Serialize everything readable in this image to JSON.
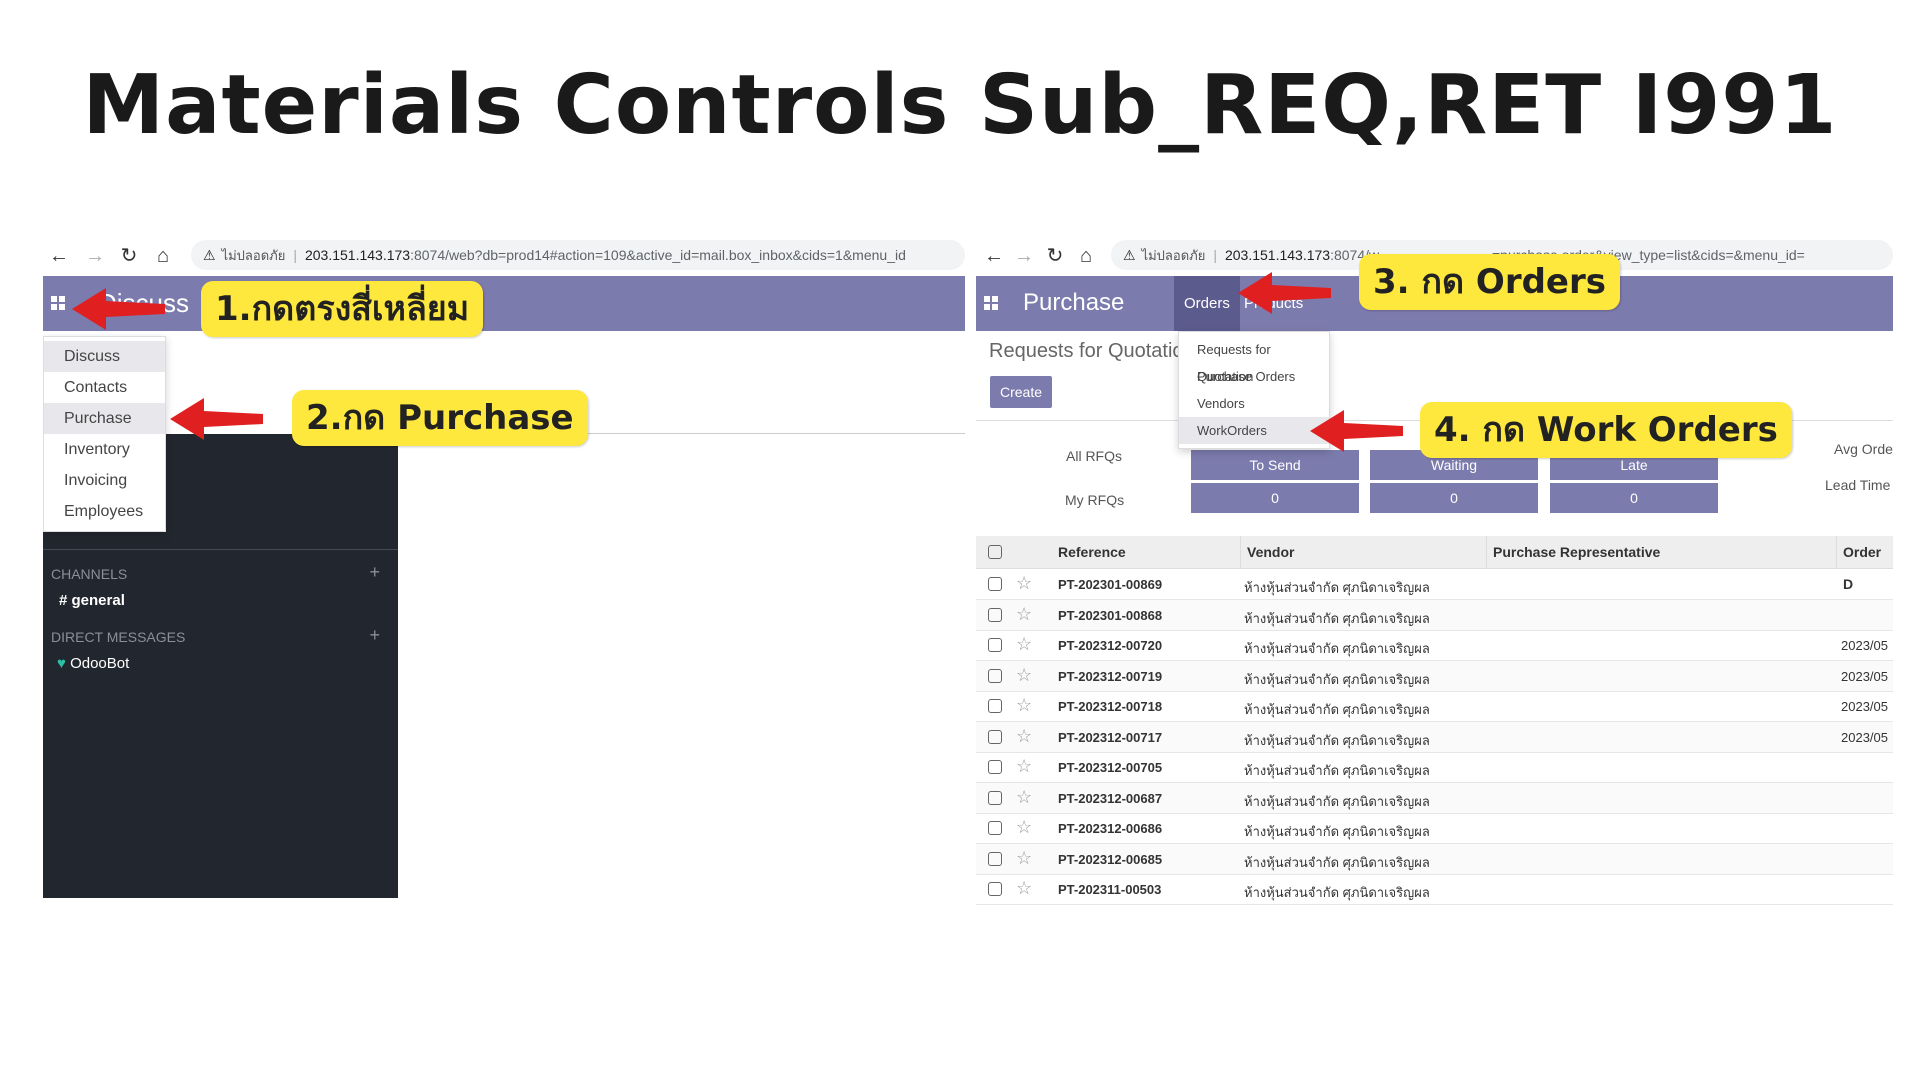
{
  "title": "Materials Controls Sub_REQ,RET I991",
  "left": {
    "security_label": "ไม่ปลอดภัย",
    "url_host": "203.151.143.173",
    "url_path": ":8074/web?db=prod14#action=109&active_id=mail.box_inbox&cids=1&menu_id",
    "app_title": "Discuss",
    "menu": [
      "Discuss",
      "Contacts",
      "Purchase",
      "Inventory",
      "Invoicing",
      "Employees"
    ],
    "channels_label": "CHANNELS",
    "channel_general": "general",
    "dm_label": "DIRECT MESSAGES",
    "dm_odoobot": "OdooBot",
    "callout1": "1.กดตรงสี่เหลี่ยม",
    "callout2": "2.กด Purchase"
  },
  "right": {
    "security_label": "ไม่ปลอดภัย",
    "url_host": "203.151.143.173",
    "url_path_a": ":8074/w",
    "url_path_b": "=purchase.order&view_type=list&cids=&menu_id=",
    "app_title": "Purchase",
    "tab_orders": "Orders",
    "tab_products": "Products",
    "orders_menu": [
      "Requests for Quotation",
      "Purchase Orders",
      "Vendors",
      "WorkOrders"
    ],
    "page_title": "Requests for Quotation",
    "create_label": "Create",
    "all_rfqs": "All RFQs",
    "my_rfqs": "My RFQs",
    "to_send": "To Send",
    "waiting": "Waiting",
    "late": "Late",
    "my_to_send": "0",
    "my_waiting": "0",
    "my_late": "0",
    "avg_order": "Avg Orde",
    "lead_time": "Lead Time",
    "columns": {
      "reference": "Reference",
      "vendor": "Vendor",
      "rep": "Purchase Representative",
      "date": "Order D"
    },
    "callout3": "3. กด Orders",
    "callout4": "4. กด Work Orders"
  },
  "rows": [
    {
      "ref": "PT-202301-00869",
      "vendor": "ห้างหุ้นส่วนจำกัด ศุภนิดาเจริญผล",
      "date": ""
    },
    {
      "ref": "PT-202301-00868",
      "vendor": "ห้างหุ้นส่วนจำกัด ศุภนิดาเจริญผล",
      "date": ""
    },
    {
      "ref": "PT-202312-00720",
      "vendor": "ห้างหุ้นส่วนจำกัด ศุภนิดาเจริญผล",
      "date": "2023/05"
    },
    {
      "ref": "PT-202312-00719",
      "vendor": "ห้างหุ้นส่วนจำกัด ศุภนิดาเจริญผล",
      "date": "2023/05"
    },
    {
      "ref": "PT-202312-00718",
      "vendor": "ห้างหุ้นส่วนจำกัด ศุภนิดาเจริญผล",
      "date": "2023/05"
    },
    {
      "ref": "PT-202312-00717",
      "vendor": "ห้างหุ้นส่วนจำกัด ศุภนิดาเจริญผล",
      "date": "2023/05"
    },
    {
      "ref": "PT-202312-00705",
      "vendor": "ห้างหุ้นส่วนจำกัด ศุภนิดาเจริญผล",
      "date": ""
    },
    {
      "ref": "PT-202312-00687",
      "vendor": "ห้างหุ้นส่วนจำกัด ศุภนิดาเจริญผล",
      "date": ""
    },
    {
      "ref": "PT-202312-00686",
      "vendor": "ห้างหุ้นส่วนจำกัด ศุภนิดาเจริญผล",
      "date": ""
    },
    {
      "ref": "PT-202312-00685",
      "vendor": "ห้างหุ้นส่วนจำกัด ศุภนิดาเจริญผล",
      "date": ""
    },
    {
      "ref": "PT-202311-00503",
      "vendor": "ห้างหุ้นส่วนจำกัด ศุภนิดาเจริญผล",
      "date": ""
    }
  ]
}
